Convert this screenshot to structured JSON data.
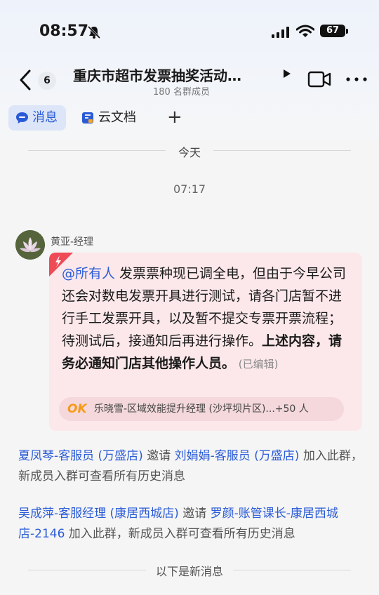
{
  "status_bar": {
    "time": "08:57",
    "battery": "67"
  },
  "header": {
    "unread_count": "6",
    "title": "重庆市超市发票抽奖活动…",
    "member_count": "180 名群成员"
  },
  "tabs": {
    "messages": "消息",
    "docs": "云文档",
    "add": "+"
  },
  "date_separator": "今天",
  "message_time": "07:17",
  "message": {
    "sender": "黄亚-经理",
    "mention": "@所有人",
    "text_part1": " 发票票种现已调全电，但由于今早公司还会对数电发票开具进行测试，请各门店暂不进行手工发票开具，以及暂不提交专票开票流程；待测试后，接通知后再进行操作。",
    "text_bold": "上述内容，请务必通知门店其他操作人员。",
    "edited_label": " (已编辑)",
    "ack_icon": "OK",
    "ack_text": "乐晓雪-区域效能提升经理 (沙坪坝片区)...+50 人"
  },
  "system_messages": [
    {
      "inviter": "夏凤琴-客服员 (万盛店)",
      "action": " 邀请 ",
      "invitee": "刘娟娟-客服员 (万盛店)",
      "suffix": " 加入此群，新成员入群可查看所有历史消息"
    },
    {
      "inviter": "吴成萍-客服经理 (康居西城店)",
      "action": " 邀请 ",
      "invitee": "罗颜-账管课长-康居西城店-2146",
      "suffix": " 加入此群，新成员入群可查看所有历史消息"
    }
  ],
  "new_messages_separator": "以下是新消息",
  "colors": {
    "accent": "#2a5bd7",
    "bubble": "#fce8ea",
    "urgent": "#ee4b57",
    "ok": "#f59a18"
  }
}
